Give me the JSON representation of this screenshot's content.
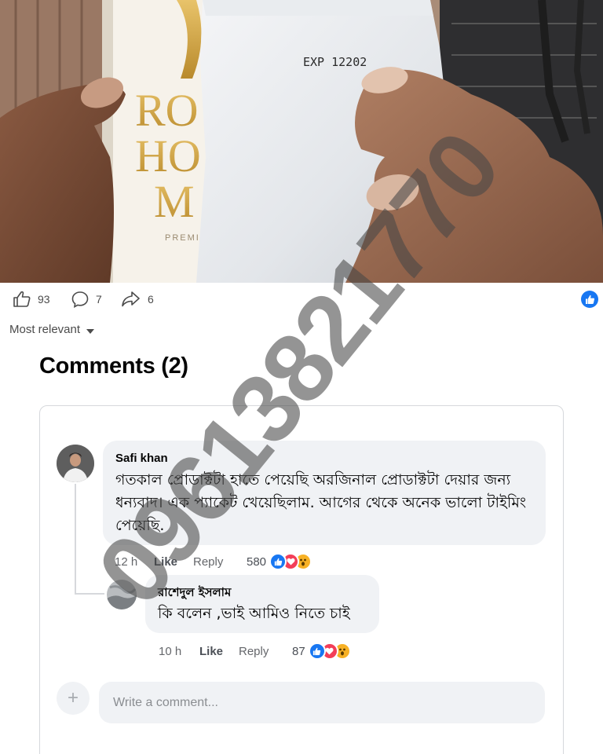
{
  "media": {
    "package_print": "EXP 12202",
    "box_text_left": [
      "RO",
      "HO",
      "M"
    ],
    "box_small_text": "PREMI"
  },
  "stats": {
    "likes": "93",
    "comments": "7",
    "shares": "6"
  },
  "sort_label": "Most relevant",
  "comments_heading": "Comments (2)",
  "comments": [
    {
      "author": "Safi khan",
      "text": "গতকাল প্রোডাক্টটা হাতে পেয়েছি অরজিনাল প্রোডাক্টটা দেয়ার জন্য ধন্যবাদ। এক প্যাকেট খেয়েছিলাম. আগের থেকে অনেক ভালো টাইমিং পেয়েছি.",
      "time": "12 h",
      "like_label": "Like",
      "reply_label": "Reply",
      "reaction_count": "580"
    },
    {
      "author": "রাশেদুল ইসলাম",
      "text": "কি বলেন ,ভাই আমিও নিতে চাই",
      "time": "10 h",
      "like_label": "Like",
      "reply_label": "Reply",
      "reaction_count": "87"
    }
  ],
  "write_placeholder": "Write a comment...",
  "watermark": "09613821770",
  "colors": {
    "fb_blue": "#1877f2",
    "love_red": "#f33e58",
    "wow_yellow": "#f7b125",
    "bubble_bg": "#f0f2f5"
  }
}
